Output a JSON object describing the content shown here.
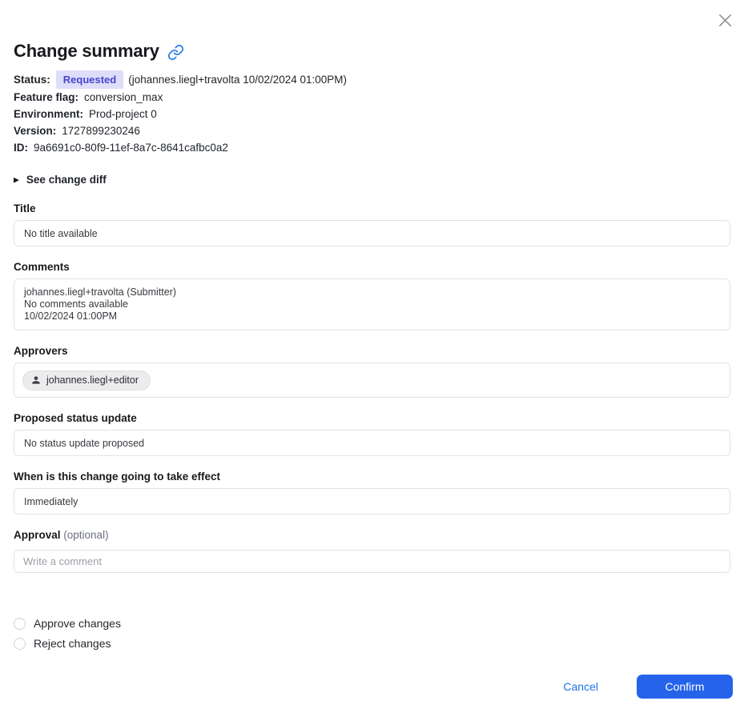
{
  "dialog": {
    "title": "Change summary"
  },
  "meta": {
    "status_label": "Status:",
    "status_badge": "Requested",
    "status_detail": "(johannes.liegl+travolta 10/02/2024 01:00PM)",
    "feature_flag_label": "Feature flag:",
    "feature_flag_value": "conversion_max",
    "environment_label": "Environment:",
    "environment_value": "Prod-project 0",
    "version_label": "Version:",
    "version_value": "1727899230246",
    "id_label": "ID:",
    "id_value": "9a6691c0-80f9-11ef-8a7c-8641cafbc0a2"
  },
  "diff_toggle": {
    "icon": "▶",
    "label": "See change diff"
  },
  "sections": {
    "title": {
      "label": "Title",
      "value": "No title available"
    },
    "comments": {
      "label": "Comments",
      "lines": [
        "johannes.liegl+travolta (Submitter)",
        "No comments available",
        "10/02/2024 01:00PM"
      ]
    },
    "approvers": {
      "label": "Approvers",
      "chip": "johannes.liegl+editor"
    },
    "proposed_status": {
      "label": "Proposed status update",
      "value": "No status update proposed"
    },
    "effect": {
      "label": "When is this change going to take effect",
      "value": "Immediately"
    },
    "approval": {
      "label": "Approval",
      "optional": "(optional)",
      "placeholder": "Write a comment"
    }
  },
  "choices": {
    "approve": "Approve changes",
    "reject": "Reject changes"
  },
  "footer": {
    "cancel": "Cancel",
    "confirm": "Confirm"
  },
  "colors": {
    "accent": "#1a73e8",
    "accent_strong": "#2563eb",
    "badge_bg": "#dedefa",
    "badge_text": "#4646cd",
    "link_icon": "#2f80ed",
    "border": "#e1e3e7"
  }
}
